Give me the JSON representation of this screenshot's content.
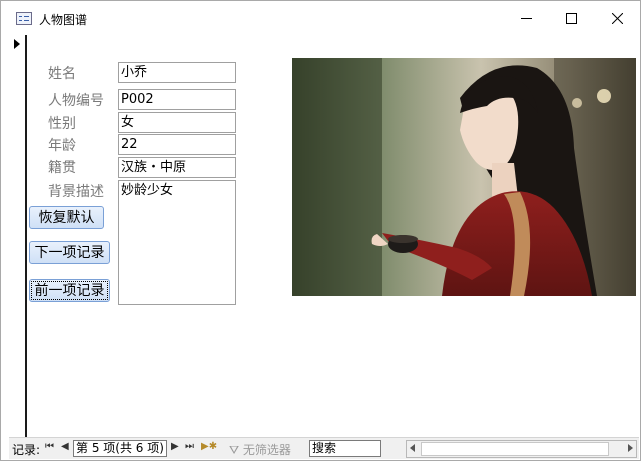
{
  "window": {
    "title": "人物图谱"
  },
  "form": {
    "fields": [
      {
        "label": "姓名",
        "value": "小乔"
      },
      {
        "label": "人物编号",
        "value": "P002"
      },
      {
        "label": "性别",
        "value": "女"
      },
      {
        "label": "年龄",
        "value": "22"
      },
      {
        "label": "籍贯",
        "value": "汉族・中原"
      },
      {
        "label": "背景描述",
        "value": "妙龄少女"
      }
    ],
    "buttons": {
      "restore": "恢复默认",
      "next": "下一项记录",
      "prev": "前一项记录"
    }
  },
  "statusbar": {
    "record_label": "记录:",
    "record_position": "第 5 项(共 6 项)",
    "filter": "无筛选器",
    "search": "搜索"
  },
  "icons": {
    "app": "form-icon",
    "minimize": "minimize-icon",
    "maximize": "maximize-icon",
    "close": "close-icon"
  }
}
